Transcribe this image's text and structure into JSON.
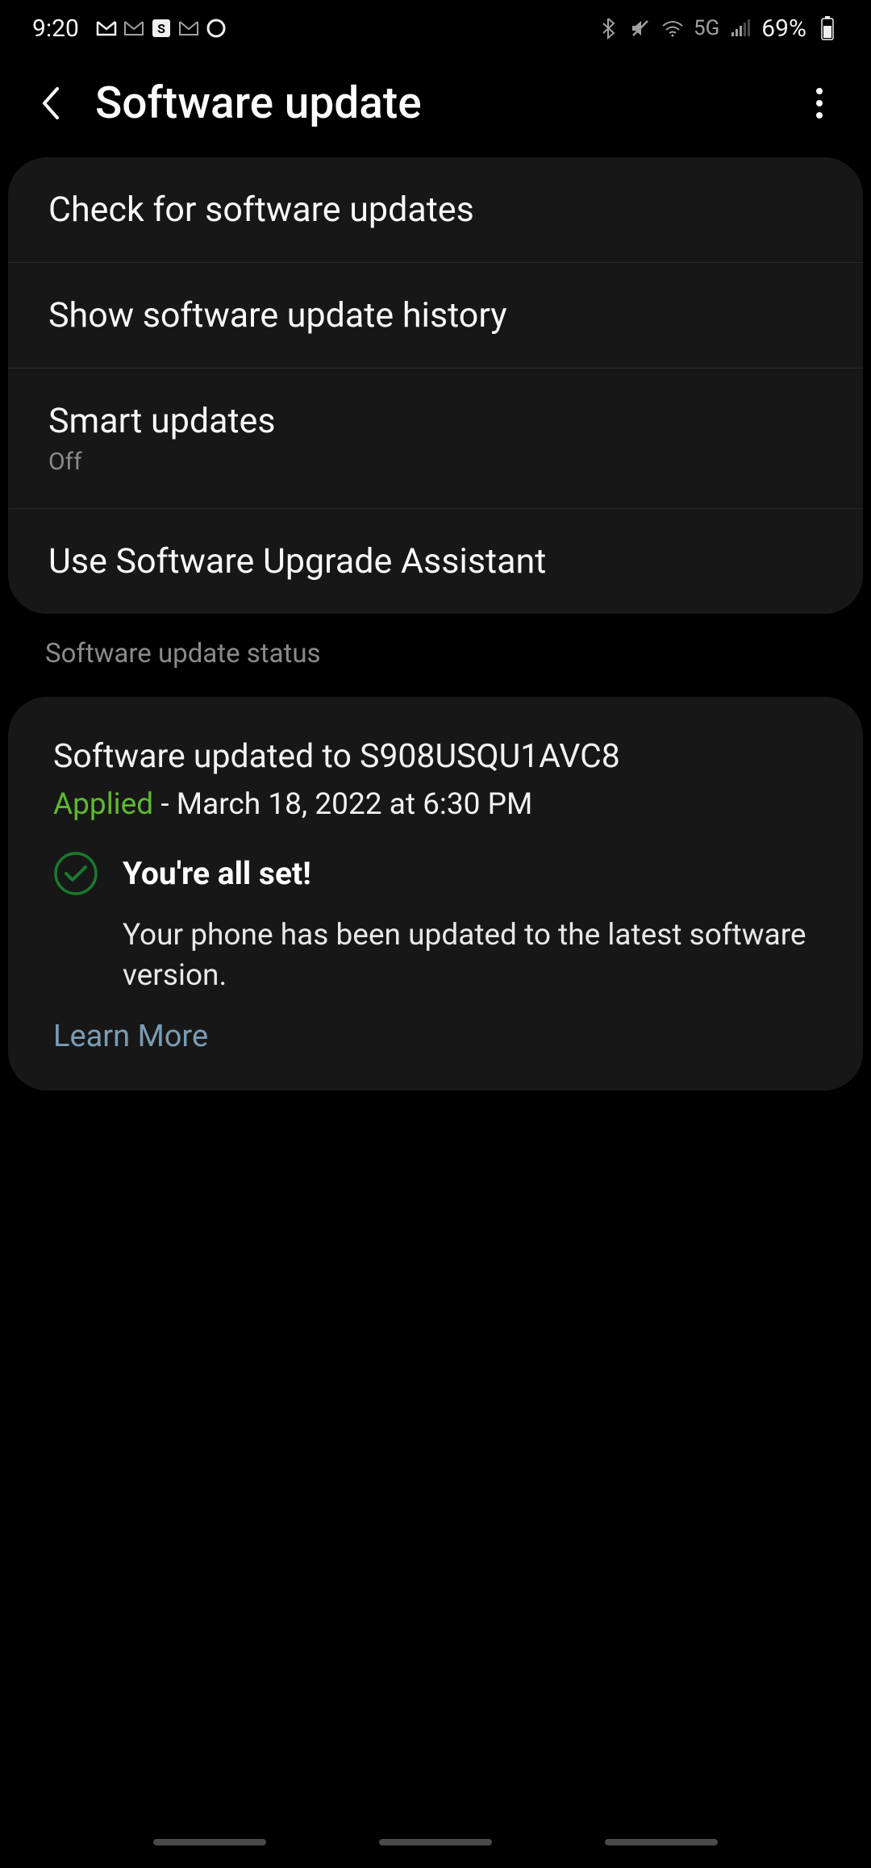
{
  "statusBar": {
    "time": "9:20",
    "networkType": "5G",
    "battery": "69%"
  },
  "header": {
    "title": "Software update"
  },
  "settingsList": {
    "checkUpdates": "Check for software updates",
    "showHistory": "Show software update history",
    "smartUpdates": {
      "title": "Smart updates",
      "status": "Off"
    },
    "upgradeAssistant": "Use Software Upgrade Assistant"
  },
  "sectionHeader": "Software update status",
  "updateStatus": {
    "version": "Software updated to S908USQU1AVC8",
    "appliedLabel": "Applied",
    "appliedDate": "March 18, 2022 at 6:30 PM",
    "allSet": "You're all set!",
    "detail": "Your phone has been updated to the latest software version.",
    "learnMore": "Learn More"
  },
  "colors": {
    "green": "#5eb832",
    "checkGreen": "#1a7a2e",
    "link": "#7a9cb5"
  }
}
